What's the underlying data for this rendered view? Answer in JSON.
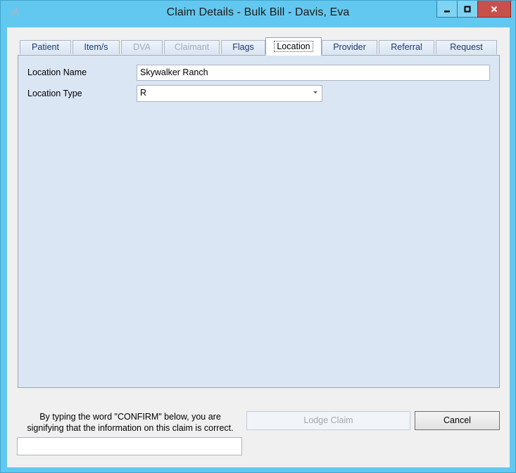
{
  "window": {
    "title": "Claim Details - Bulk Bill - Davis, Eva",
    "minimize": "▁",
    "maximize": "◻",
    "close": "✕"
  },
  "tabs": [
    {
      "label": "Patient",
      "state": "normal"
    },
    {
      "label": "Item/s",
      "state": "normal"
    },
    {
      "label": "DVA",
      "state": "disabled"
    },
    {
      "label": "Claimant",
      "state": "disabled"
    },
    {
      "label": "Flags",
      "state": "normal"
    },
    {
      "label": "Location",
      "state": "active"
    },
    {
      "label": "Provider",
      "state": "normal"
    },
    {
      "label": "Referral",
      "state": "normal"
    },
    {
      "label": "Request",
      "state": "normal"
    }
  ],
  "location": {
    "name_label": "Location Name",
    "name_value": "Skywalker Ranch",
    "type_label": "Location Type",
    "type_value": "R"
  },
  "footer": {
    "confirm_text_line1": "By typing the word \"CONFIRM\" below, you are",
    "confirm_text_line2": "signifying that the information on this claim is correct.",
    "confirm_value": "",
    "lodge_label": "Lodge Claim",
    "cancel_label": "Cancel"
  },
  "colors": {
    "titlebar": "#63c8ef",
    "panel": "#dbe6f4",
    "close_button": "#c7504a"
  }
}
